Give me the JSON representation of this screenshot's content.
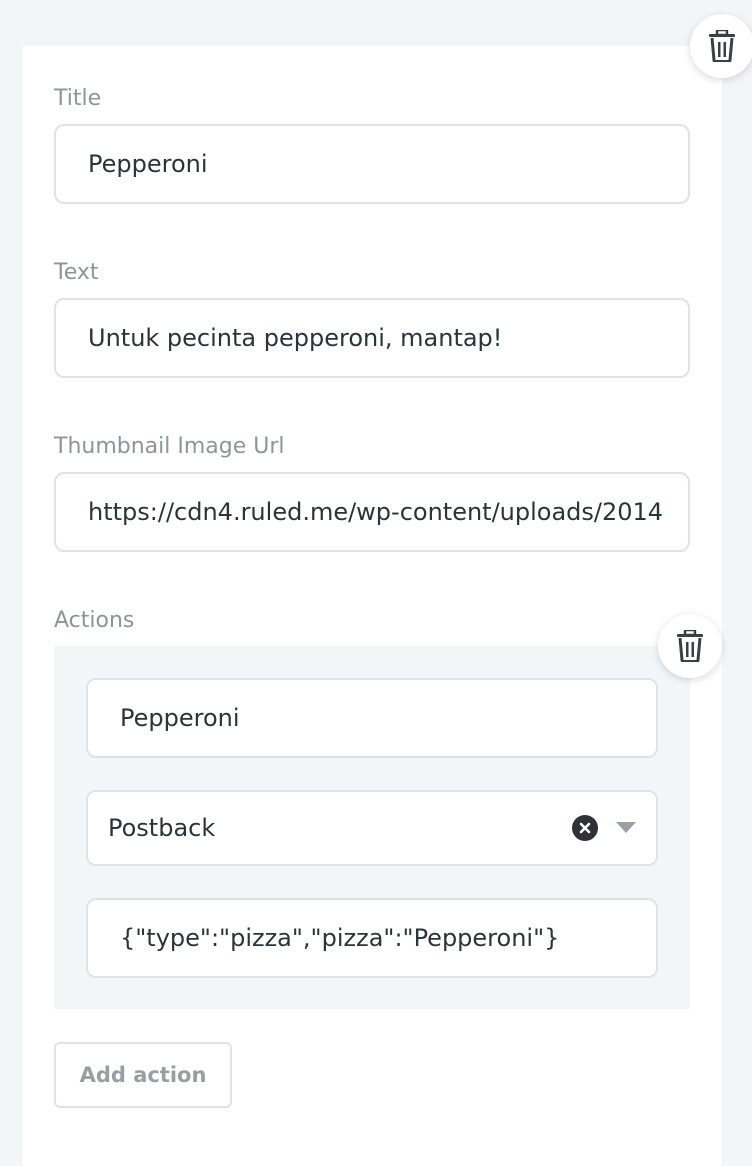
{
  "form": {
    "title_label": "Title",
    "title_value": "Pepperoni",
    "text_label": "Text",
    "text_value": "Untuk pecinta pepperoni, mantap!",
    "thumbnail_label": "Thumbnail Image Url",
    "thumbnail_value": "https://cdn4.ruled.me/wp-content/uploads/2014",
    "actions_label": "Actions"
  },
  "action": {
    "label_value": "Pepperoni",
    "type_value": "Postback",
    "payload_value": "{\"type\":\"pizza\",\"pizza\":\"Pepperoni\"}"
  },
  "buttons": {
    "add_action": "Add action"
  },
  "icons": {
    "card_delete": "trash-icon",
    "action_delete": "trash-icon",
    "clear": "close-icon",
    "dropdown": "chevron-down-icon"
  },
  "colors": {
    "background": "#f4f5f7",
    "card": "#ffffff",
    "border": "#e0e2e5",
    "label": "#8f949a",
    "text": "#2e3338"
  }
}
